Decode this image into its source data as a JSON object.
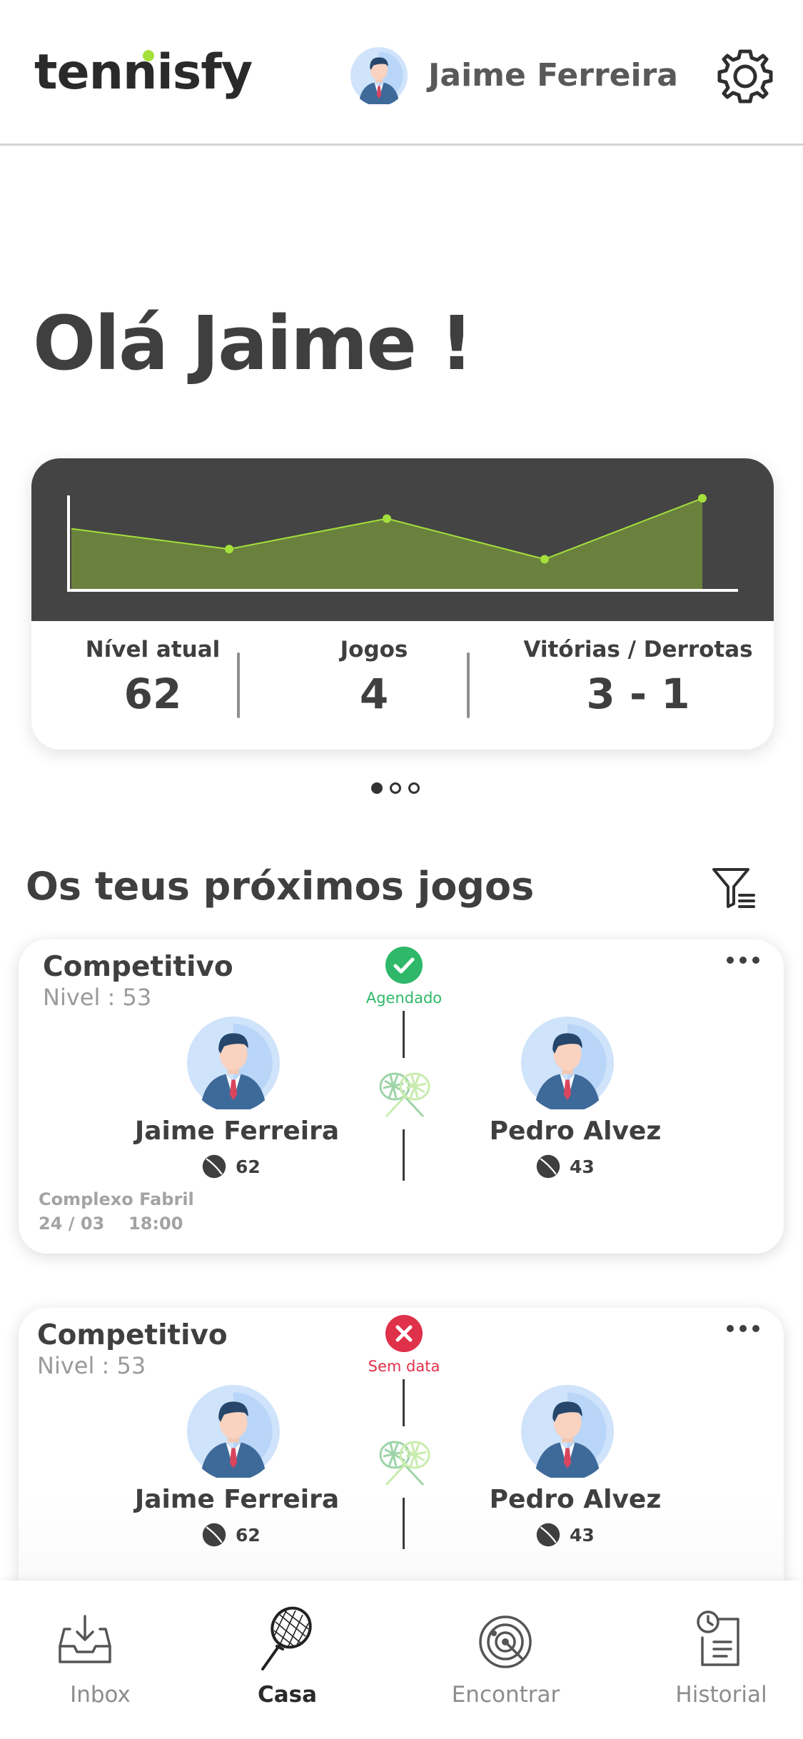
{
  "app": {
    "logo": "tennisfy",
    "accent": "#a4e03c"
  },
  "header": {
    "user_name": "Jaime Ferreira",
    "settings_icon": "gear-icon"
  },
  "greeting": "Olá Jaime !",
  "stats": {
    "chart_data": {
      "type": "area",
      "x": [
        1,
        2,
        3,
        4,
        5
      ],
      "values": [
        59,
        57,
        60,
        56,
        62
      ],
      "color": "#a4e03c",
      "fill": "#6a813e",
      "background": "#444444"
    },
    "level_label": "Nível atual",
    "level_value": "62",
    "games_label": "Jogos",
    "games_value": "4",
    "wl_label": "Vitórias / Derrotas",
    "wl_value": "3 - 1"
  },
  "carousel": {
    "count": 3,
    "active": 0
  },
  "upcoming": {
    "title": "Os teus próximos jogos",
    "filter_icon": "filter-icon",
    "matches": [
      {
        "type": "Competitivo",
        "level": "Nivel : 53",
        "status": "Agendado",
        "status_kind": "ok",
        "player1": {
          "name": "Jaime Ferreira",
          "level": "62"
        },
        "player2": {
          "name": "Pedro Alvez",
          "level": "43"
        },
        "place": "Complexo Fabril",
        "date": "24 / 03",
        "time": "18:00"
      },
      {
        "type": "Competitivo",
        "level": "Nivel : 53",
        "status": "Sem data",
        "status_kind": "bad",
        "player1": {
          "name": "Jaime Ferreira",
          "level": "62"
        },
        "player2": {
          "name": "Pedro Alvez",
          "level": "43"
        }
      }
    ]
  },
  "nav": {
    "inbox": "Inbox",
    "home": "Casa",
    "find": "Encontrar",
    "history": "Historial",
    "active": "home"
  }
}
